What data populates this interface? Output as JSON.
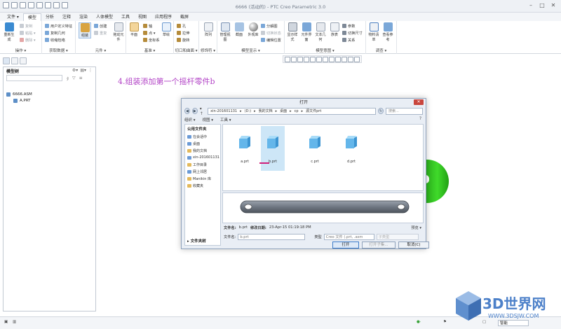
{
  "window": {
    "title": "6666 (活动的) - PTC Creo Parametric 3.0"
  },
  "tabs": [
    "文件 ▾",
    "模型",
    "分析",
    "注释",
    "渲染",
    "人体模型",
    "工具",
    "视图",
    "应用程序",
    "截屏"
  ],
  "active_tab": "模型",
  "ribbon": {
    "groups": [
      {
        "caption": "操作 ▾",
        "big": [
          "重新生成"
        ],
        "small": [
          "复制",
          "粘贴 ▾",
          "删除 ▾"
        ]
      },
      {
        "caption": "获取数据 ▾",
        "big": [],
        "small": [
          "用户定义特征",
          "复制几何",
          "收缩包络"
        ]
      },
      {
        "caption": "元件 ▾",
        "big": [
          "组装",
          "拖动元件"
        ],
        "small": [
          "创建",
          "重复"
        ]
      },
      {
        "caption": "基准 ▾",
        "big": [
          "平面"
        ],
        "small": [
          "轴",
          "点 ▾",
          "坐标系"
        ]
      },
      {
        "caption": "切口和曲面 ▾",
        "big": [
          "草绘"
        ],
        "small": [
          "孔",
          "拉伸",
          "旋转"
        ]
      },
      {
        "caption": "修饰符 ▾",
        "big": [
          "阵列"
        ],
        "small": []
      },
      {
        "caption": "模型显示 ▾",
        "big": [
          "管理视图",
          "截面",
          "外观库"
        ],
        "small": [
          "分解图",
          "切换状态",
          "编辑位置"
        ]
      },
      {
        "caption": "模型意图 ▾",
        "big": [
          "显示样式",
          "元件界面",
          "文本几何",
          "族表"
        ],
        "small": [
          "参数",
          "切换尺寸",
          "关系"
        ]
      },
      {
        "caption": "调查 ▾",
        "big": [
          "物料清单",
          "查看参考"
        ],
        "small": []
      }
    ]
  },
  "model_tree": {
    "title": "模型树",
    "items": [
      {
        "label": "6666.ASM",
        "level": 0
      },
      {
        "label": "A.PRT",
        "level": 1
      }
    ]
  },
  "annotation": "4.组装添加第一个摇杆零件b",
  "dialog": {
    "title": "打开",
    "breadcrumbs": [
      "xin-201601131",
      "(D:)",
      "我的文档",
      "桌面",
      "cp",
      "源文件prt"
    ],
    "search_placeholder": "搜索...",
    "toolbar": [
      "组织 ▾",
      "视图 ▾",
      "工具 ▾"
    ],
    "sidebar_header": "公用文件夹",
    "sidebar_items": [
      {
        "label": "在会话中",
        "icon": "blue"
      },
      {
        "label": "桌面",
        "icon": "blue"
      },
      {
        "label": "我的文档",
        "icon": "folder"
      },
      {
        "label": "xin-201601131",
        "icon": "blue"
      },
      {
        "label": "工作目录",
        "icon": "folder"
      },
      {
        "label": "网上邻居",
        "icon": "blue"
      },
      {
        "label": "Manikin 库",
        "icon": "folder"
      },
      {
        "label": "收藏夹",
        "icon": "folder"
      }
    ],
    "folder_tree_label": "▸ 文件夹树",
    "files": [
      "a.prt",
      "b.prt",
      "c.prt",
      "d.prt"
    ],
    "selected_file": "b.prt",
    "file_info": {
      "name_label": "文件名:",
      "name": "b.prt",
      "date_label": "修改日期:",
      "date": "23-Apr-15 01:19:18 PM"
    },
    "preview_label": "预览 ▾",
    "filename_label": "文件名:",
    "filename_value": "b.prt",
    "type_label": "类型",
    "type_value": "Creo 文件 (.prt, .asm",
    "subtype_placeholder": "子类型",
    "buttons": {
      "open": "打开",
      "open_rep": "打开子集...",
      "cancel": "取消(C)"
    }
  },
  "status": {
    "selection_filter": "智能"
  },
  "watermark": {
    "text": "3D世界网",
    "url": "WWW.3DSJW.COM"
  },
  "colors": {
    "annotation": "#b243c6",
    "green_model": "#3fda2a",
    "file_icon": "#64b6ea",
    "selection": "#cde6f7"
  }
}
